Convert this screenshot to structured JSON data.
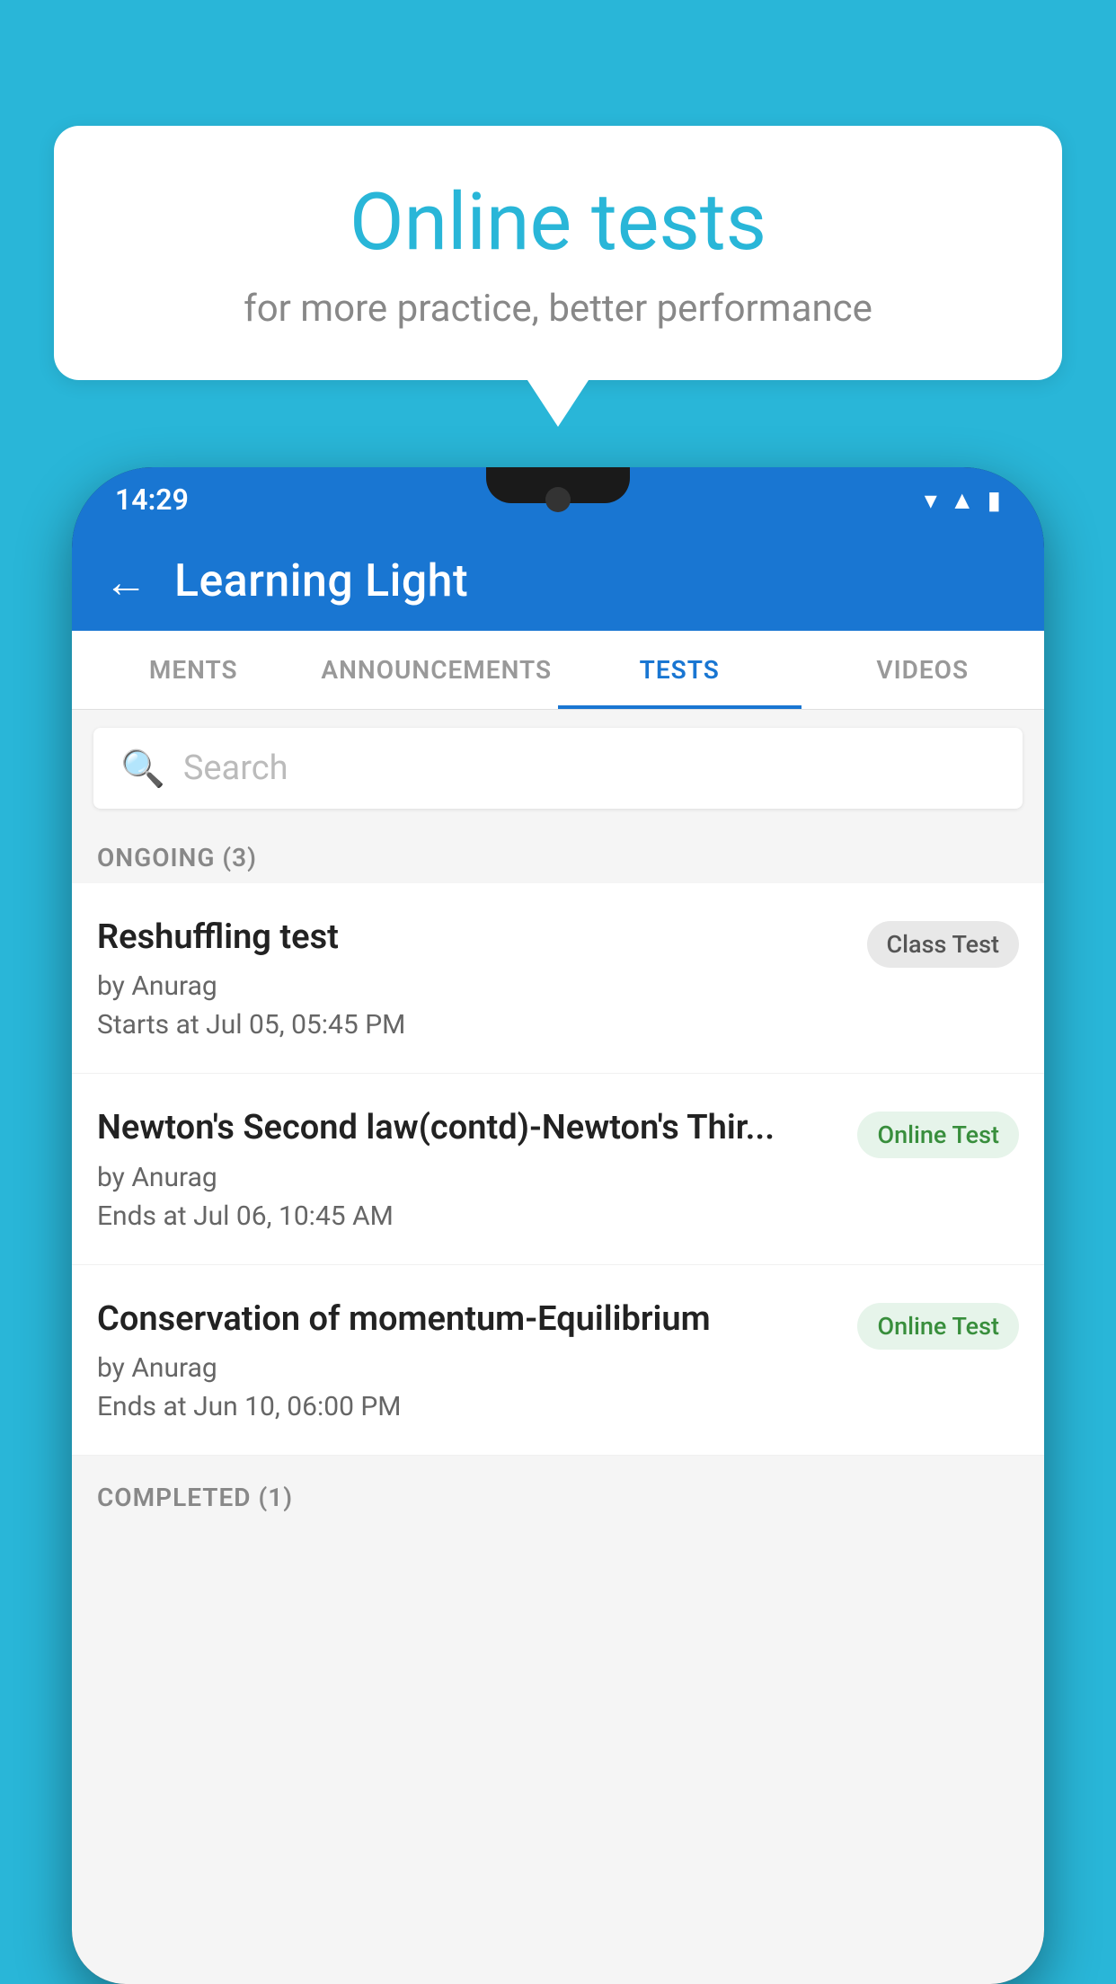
{
  "background": {
    "color": "#29b6d8"
  },
  "speech_bubble": {
    "title": "Online tests",
    "subtitle": "for more practice, better performance"
  },
  "phone": {
    "status_bar": {
      "time": "14:29"
    },
    "app_bar": {
      "title": "Learning Light",
      "back_label": "←"
    },
    "tabs": [
      {
        "label": "MENTS",
        "active": false
      },
      {
        "label": "ANNOUNCEMENTS",
        "active": false
      },
      {
        "label": "TESTS",
        "active": true
      },
      {
        "label": "VIDEOS",
        "active": false
      }
    ],
    "search": {
      "placeholder": "Search"
    },
    "ongoing_section": {
      "label": "ONGOING (3)"
    },
    "tests": [
      {
        "name": "Reshuffling test",
        "author": "by Anurag",
        "time_label": "Starts at",
        "time_value": "Jul 05, 05:45 PM",
        "badge": "Class Test",
        "badge_type": "class"
      },
      {
        "name": "Newton's Second law(contd)-Newton's Thir...",
        "author": "by Anurag",
        "time_label": "Ends at",
        "time_value": "Jul 06, 10:45 AM",
        "badge": "Online Test",
        "badge_type": "online"
      },
      {
        "name": "Conservation of momentum-Equilibrium",
        "author": "by Anurag",
        "time_label": "Ends at",
        "time_value": "Jun 10, 06:00 PM",
        "badge": "Online Test",
        "badge_type": "online"
      }
    ],
    "completed_section": {
      "label": "COMPLETED (1)"
    }
  }
}
